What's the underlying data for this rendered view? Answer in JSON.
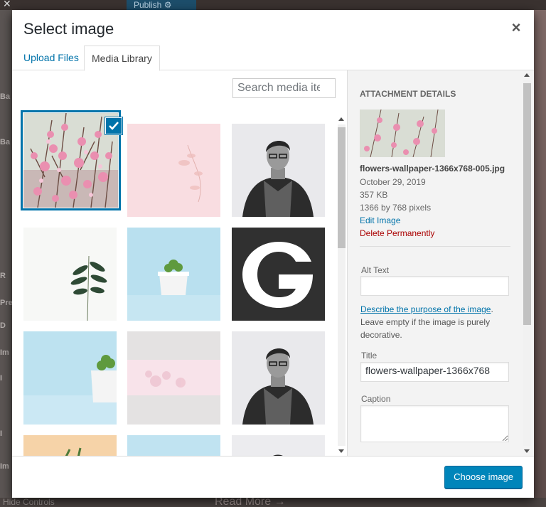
{
  "background": {
    "publish_label": "Publish",
    "left_letters": [
      "Ba",
      "Ba",
      "R",
      "Pre",
      "D",
      "Im",
      "I",
      "I",
      "Im"
    ],
    "hide_controls": "Hide Controls",
    "read_more": "Read More →"
  },
  "modal": {
    "title": "Select image",
    "close_icon": "close-icon",
    "tabs": [
      {
        "label": "Upload Files",
        "active": false
      },
      {
        "label": "Media Library",
        "active": true
      }
    ]
  },
  "browser": {
    "search_placeholder": "Search media ite",
    "items": [
      {
        "name": "flowers-branch",
        "selected": true
      },
      {
        "name": "pink-leaf-sketch"
      },
      {
        "name": "man-portrait"
      },
      {
        "name": "green-plant"
      },
      {
        "name": "succulent-pot"
      },
      {
        "name": "g-logo"
      },
      {
        "name": "succulent-pot-blue"
      },
      {
        "name": "pink-flowers-banner"
      },
      {
        "name": "man-portrait-2"
      },
      {
        "name": "plant-orange"
      },
      {
        "name": "blue-partial"
      },
      {
        "name": "man-portrait-3"
      }
    ]
  },
  "attachment": {
    "heading": "Attachment Details",
    "filename": "flowers-wallpaper-1366x768-005.jpg",
    "date": "October 29, 2019",
    "size": "357 KB",
    "dimensions": "1366 by 768 pixels",
    "edit_link": "Edit Image",
    "delete_link": "Delete Permanently",
    "alt_label": "Alt Text",
    "alt_value": "",
    "alt_help_link": "Describe the purpose of the image",
    "alt_help_rest": ". Leave empty if the image is purely decorative.",
    "title_label": "Title",
    "title_value": "flowers-wallpaper-1366x768",
    "caption_label": "Caption",
    "caption_value": ""
  },
  "toolbar": {
    "choose_label": "Choose image"
  },
  "colors": {
    "accent": "#0073aa",
    "button": "#0085ba",
    "delete": "#aa0000"
  }
}
